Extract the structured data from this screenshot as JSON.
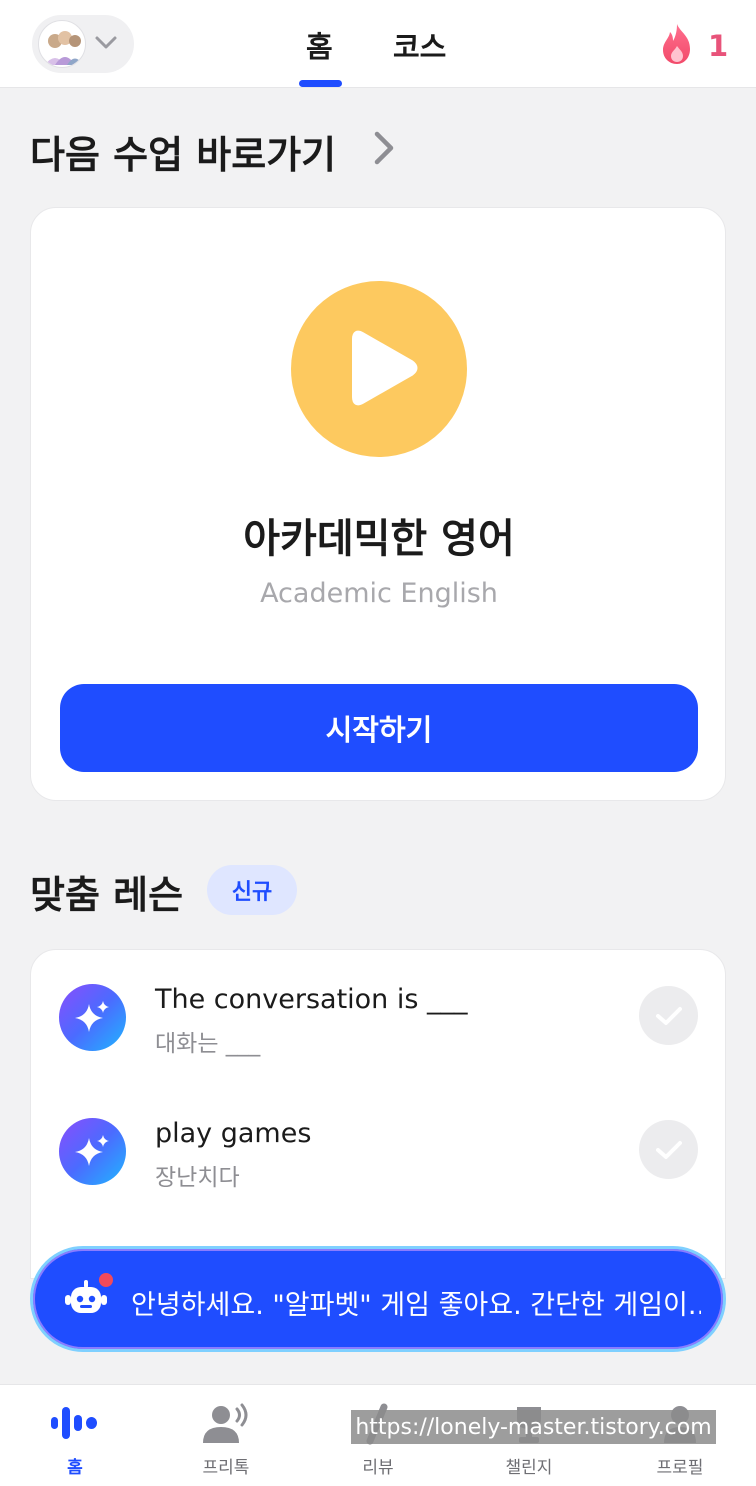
{
  "header": {
    "tabs": [
      {
        "label": "홈",
        "active": true
      },
      {
        "label": "코스",
        "active": false
      }
    ],
    "streak_count": "1",
    "accent_color": "#1f4dff"
  },
  "next_lesson": {
    "section_title": "다음 수업 바로가기",
    "title": "아카데믹한 영어",
    "subtitle": "Academic English",
    "start_label": "시작하기"
  },
  "custom_lessons": {
    "section_title": "맞춤 레슨",
    "badge": "신규",
    "items": [
      {
        "title": "The conversation is ___",
        "subtitle": "대화는 ___",
        "icon": "sparkle-icon",
        "completed": false
      },
      {
        "title": "play games",
        "subtitle": "장난치다",
        "icon": "sparkle-icon",
        "completed": false
      }
    ]
  },
  "chat": {
    "message": "안녕하세요. \"알파벳\" 게임 좋아요. 간단한 게임이..."
  },
  "bottom_nav": {
    "items": [
      {
        "label": "홈",
        "icon": "voice-wave-icon",
        "active": true
      },
      {
        "label": "프리톡",
        "icon": "speaking-person-icon",
        "active": false
      },
      {
        "label": "리뷰",
        "icon": "review-icon",
        "active": false
      },
      {
        "label": "챌린지",
        "icon": "trophy-icon",
        "active": false
      },
      {
        "label": "프로필",
        "icon": "profile-icon",
        "active": false
      }
    ]
  },
  "watermark": "https://lonely-master.tistory.com"
}
